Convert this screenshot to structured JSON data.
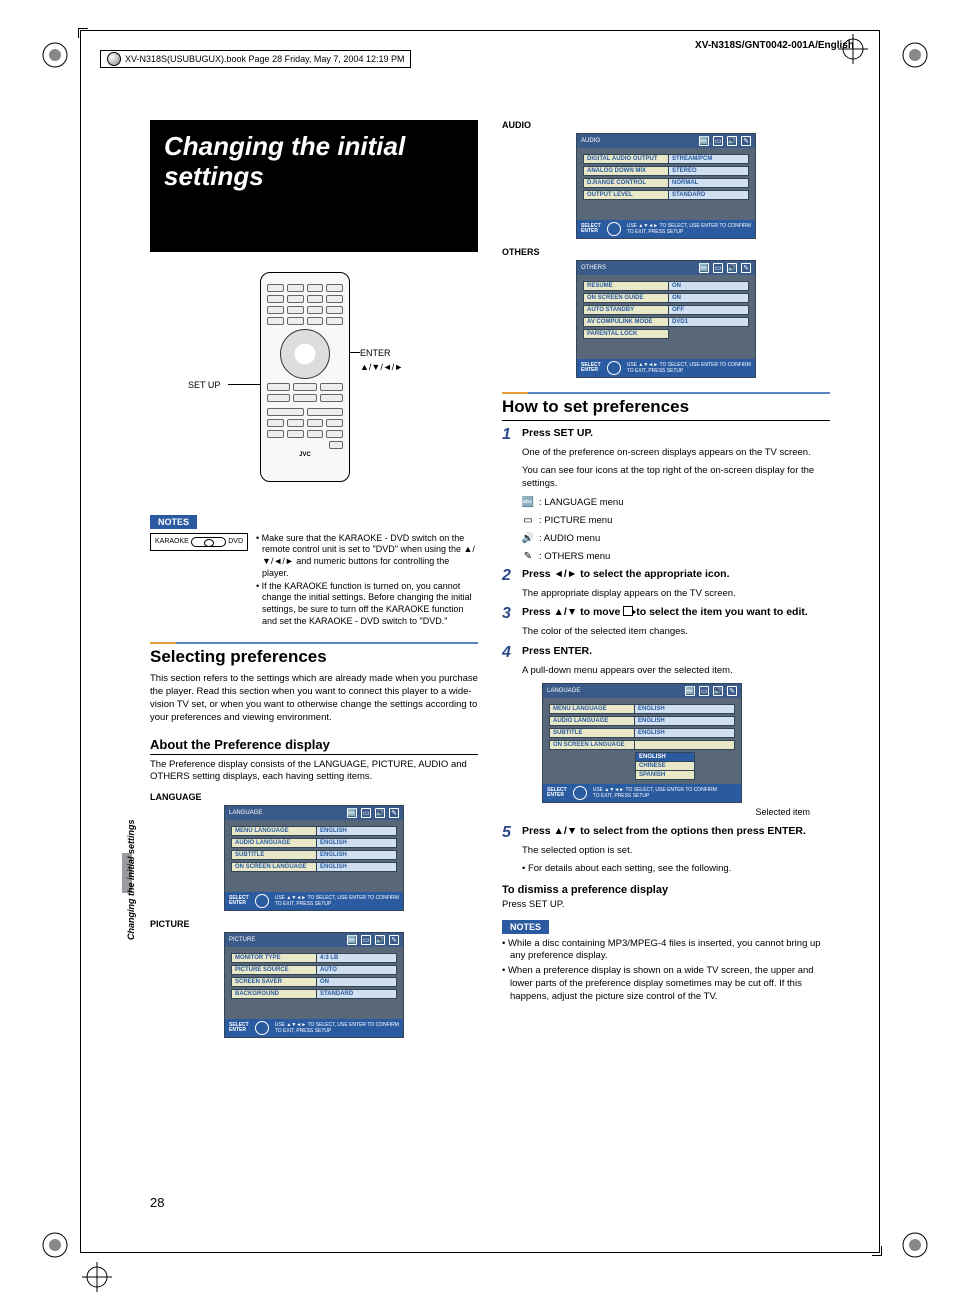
{
  "meta": {
    "book_info": "XV-N318S(USUBUGUX).book  Page 28  Friday, May 7, 2004  12:19 PM",
    "doc_id": "XV-N318S/GNT0042-001A/English",
    "page_number": "28",
    "side_label": "Changing the initial settings"
  },
  "title": "Changing the initial settings",
  "remote": {
    "setup_label": "SET UP",
    "enter_label": "ENTER",
    "arrows_label": "▲/▼/◄/►",
    "brand": "JVC"
  },
  "notes_badge": "NOTES",
  "switch": {
    "left": "KARAOKE",
    "right": "DVD"
  },
  "notes1": [
    "• Make sure that the KARAOKE - DVD switch on the remote control unit is set to \"DVD\" when using the ▲/▼/◄/► and numeric buttons for controlling the player.",
    "• If the KARAOKE function is turned on, you cannot change the initial settings. Before changing the initial settings, be sure to turn off the KARAOKE function and set the KARAOKE - DVD switch to \"DVD.\""
  ],
  "selecting_heading": "Selecting preferences",
  "selecting_body": "This section refers to the settings which are already made when you purchase the player. Read this section when you want to connect this player to a wide-vision TV set, or when you want to otherwise change the settings according to your preferences and viewing environment.",
  "about_heading": "About the Preference display",
  "about_body": "The Preference display consists of the LANGUAGE, PICTURE, AUDIO and OTHERS setting displays, each having setting items.",
  "osd_foot": {
    "select": "SELECT",
    "enter": "ENTER",
    "hint1": "USE ▲▼◄► TO SELECT, USE ENTER TO CONFIRM",
    "hint2": "TO EXIT, PRESS SETUP"
  },
  "menus": {
    "language": {
      "label": "LANGUAGE",
      "title": "LANGUAGE",
      "rows": [
        {
          "k": "MENU LANGUAGE",
          "v": "ENGLISH"
        },
        {
          "k": "AUDIO LANGUAGE",
          "v": "ENGLISH"
        },
        {
          "k": "SUBTITLE",
          "v": "ENGLISH"
        },
        {
          "k": "ON SCREEN LANGUAGE",
          "v": "ENGLISH"
        }
      ]
    },
    "picture": {
      "label": "PICTURE",
      "title": "PICTURE",
      "rows": [
        {
          "k": "MONITOR TYPE",
          "v": "4:3 LB"
        },
        {
          "k": "PICTURE SOURCE",
          "v": "AUTO"
        },
        {
          "k": "SCREEN SAVER",
          "v": "ON"
        },
        {
          "k": "BACKGROUND",
          "v": "STANDARD"
        }
      ]
    },
    "audio": {
      "label": "AUDIO",
      "title": "AUDIO",
      "rows": [
        {
          "k": "DIGITAL AUDIO OUTPUT",
          "v": "STREAM/PCM"
        },
        {
          "k": "ANALOG DOWN MIX",
          "v": "STEREO"
        },
        {
          "k": "D.RANGE CONTROL",
          "v": "NORMAL"
        },
        {
          "k": "OUTPUT LEVEL",
          "v": "STANDARD"
        }
      ]
    },
    "others": {
      "label": "OTHERS",
      "title": "OTHERS",
      "rows": [
        {
          "k": "RESUME",
          "v": "ON"
        },
        {
          "k": "ON SCREEN GUIDE",
          "v": "ON"
        },
        {
          "k": "AUTO STANDBY",
          "v": "OFF"
        },
        {
          "k": "AV COMPULINK MODE",
          "v": "DVD1"
        },
        {
          "k": "PARENTAL LOCK",
          "v": ""
        }
      ]
    },
    "dropdown": {
      "title": "LANGUAGE",
      "rows": [
        {
          "k": "MENU LANGUAGE",
          "v": "ENGLISH"
        },
        {
          "k": "AUDIO LANGUAGE",
          "v": "ENGLISH"
        },
        {
          "k": "SUBTITLE",
          "v": "ENGLISH"
        },
        {
          "k": "ON SCREEN LANGUAGE",
          "v": ""
        }
      ],
      "options": [
        "ENGLISH",
        "CHINESE",
        "SPANISH"
      ]
    }
  },
  "howto_heading": "How to set preferences",
  "steps": {
    "s1_title": "Press SET UP.",
    "s1_body1": "One of the preference on-screen displays appears on the TV screen.",
    "s1_body2": "You can see four icons at the top right of the on-screen display for the settings.",
    "icon_lang": ": LANGUAGE menu",
    "icon_pict": ": PICTURE menu",
    "icon_audio": ": AUDIO menu",
    "icon_others": ": OTHERS menu",
    "s2_title": "Press ◄/► to select the appropriate icon.",
    "s2_body": "The appropriate display appears on the TV screen.",
    "s3_title_a": "Press ▲/▼ to move ",
    "s3_title_b": " to select the item you want to edit.",
    "s3_body": "The color of the selected item changes.",
    "s4_title": "Press ENTER.",
    "s4_body": "A pull-down menu appears over the selected item.",
    "selected_item": "Selected item",
    "s5_title": "Press ▲/▼ to select from the options then press ENTER.",
    "s5_body1": "The selected option is set.",
    "s5_body2": "• For details about each setting, see the following."
  },
  "dismiss_heading": "To dismiss a preference display",
  "dismiss_body": "Press SET UP.",
  "notes2": [
    "• While a disc containing MP3/MPEG-4 files is inserted, you cannot bring up any preference display.",
    "• When a preference display is shown on a wide TV screen, the upper and lower parts of the preference display sometimes may be cut off. If this happens, adjust the picture size control of the TV."
  ]
}
